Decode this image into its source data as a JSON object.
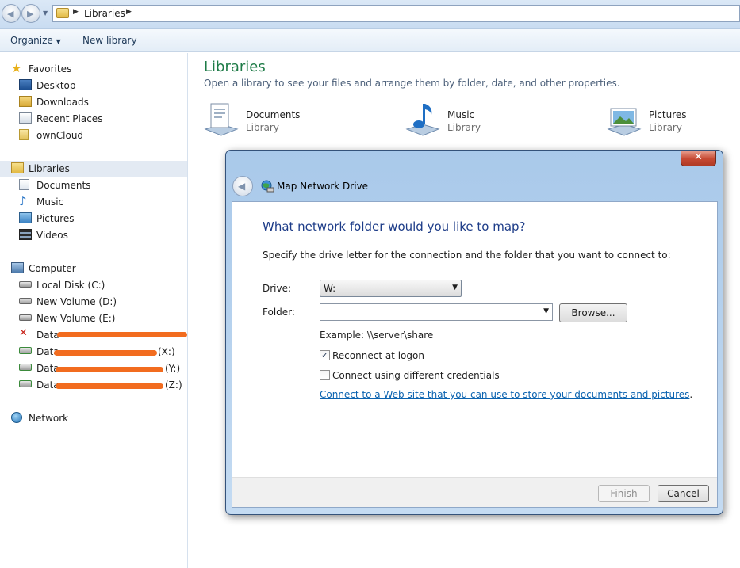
{
  "address_bar": {
    "crumb": "Libraries"
  },
  "toolbar": {
    "organize_label": "Organize",
    "new_library_label": "New library"
  },
  "sidebar": {
    "favorites": {
      "label": "Favorites",
      "items": [
        "Desktop",
        "Downloads",
        "Recent Places",
        "ownCloud"
      ]
    },
    "libraries": {
      "label": "Libraries",
      "items": [
        "Documents",
        "Music",
        "Pictures",
        "Videos"
      ]
    },
    "computer": {
      "label": "Computer",
      "drives": [
        "Local Disk (C:)",
        "New Volume (D:)",
        "New Volume (E:)"
      ],
      "network_drives": [
        {
          "prefix": "Data",
          "suffix": ""
        },
        {
          "prefix": "Data",
          "suffix": "(X:)"
        },
        {
          "prefix": "Data",
          "suffix": "(Y:)"
        },
        {
          "prefix": "Data",
          "suffix": "(Z:)"
        }
      ]
    },
    "network": {
      "label": "Network"
    }
  },
  "content": {
    "title": "Libraries",
    "subtitle": "Open a library to see your files and arrange them by folder, date, and other properties.",
    "libraries": [
      {
        "name": "Documents",
        "type": "Library"
      },
      {
        "name": "Music",
        "type": "Library"
      },
      {
        "name": "Pictures",
        "type": "Library"
      }
    ]
  },
  "dialog": {
    "title": "Map Network Drive",
    "close_label": "✕",
    "heading": "What network folder would you like to map?",
    "instruction": "Specify the drive letter for the connection and the folder that you want to connect to:",
    "drive_label": "Drive:",
    "drive_value": "W:",
    "folder_label": "Folder:",
    "folder_value": "",
    "browse_label": "Browse...",
    "example": "Example: \\\\server\\share",
    "reconnect_label": "Reconnect at logon",
    "reconnect_checked": true,
    "credentials_label": "Connect using different credentials",
    "credentials_checked": false,
    "web_link": "Connect to a Web site that you can use to store your documents and pictures",
    "web_link_suffix": ".",
    "finish_label": "Finish",
    "cancel_label": "Cancel"
  }
}
